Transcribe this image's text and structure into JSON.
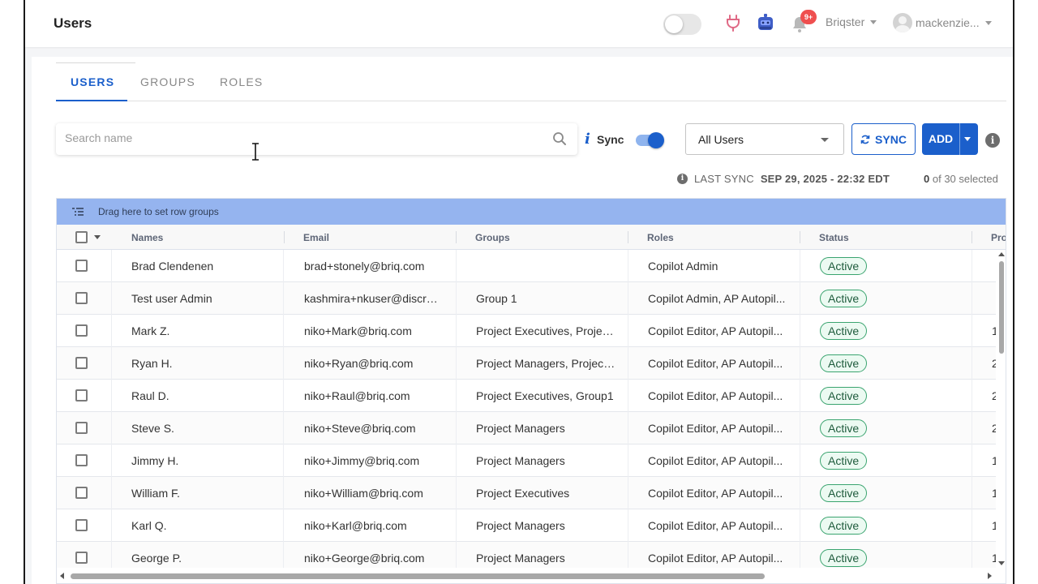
{
  "header": {
    "title": "Users",
    "notification_count": "9+",
    "org_name": "Briqster",
    "user_name": "mackenzie..."
  },
  "tabs": [
    {
      "label": "USERS",
      "active": true
    },
    {
      "label": "GROUPS",
      "active": false
    },
    {
      "label": "ROLES",
      "active": false
    }
  ],
  "toolbar": {
    "search_placeholder": "Search name",
    "search_value": "",
    "info_glyph": "i",
    "sync_label": "Sync",
    "sync_toggle_on": true,
    "filter_selected": "All Users",
    "sync_button": "SYNC",
    "add_button": "ADD",
    "help_glyph": "i"
  },
  "status": {
    "last_sync_label": "LAST SYNC",
    "last_sync_value": "SEP 29, 2025 - 22:32 EDT",
    "selected_count": "0",
    "selected_suffix": "of 30 selected"
  },
  "grid": {
    "group_panel_text": "Drag here to set row groups",
    "columns": [
      "Names",
      "Email",
      "Groups",
      "Roles",
      "Status",
      "Pro"
    ],
    "rows": [
      {
        "name": "Brad Clendenen",
        "email": "brad+stonely@briq.com",
        "groups": "",
        "roles": "Copilot Admin",
        "status": "Active",
        "extra": ""
      },
      {
        "name": "Test user Admin",
        "email": "kashmira+nkuser@discret...",
        "groups": "Group 1",
        "roles": "Copilot Admin, AP Autopil...",
        "status": "Active",
        "extra": ""
      },
      {
        "name": "Mark Z.",
        "email": "niko+Mark@briq.com",
        "groups": "Project Executives, Projec...",
        "roles": "Copilot Editor, AP Autopil...",
        "status": "Active",
        "extra": "1"
      },
      {
        "name": "Ryan H.",
        "email": "niko+Ryan@briq.com",
        "groups": "Project Managers, Project...",
        "roles": "Copilot Editor, AP Autopil...",
        "status": "Active",
        "extra": "2"
      },
      {
        "name": "Raul D.",
        "email": "niko+Raul@briq.com",
        "groups": "Project Executives, Group1",
        "roles": "Copilot Editor, AP Autopil...",
        "status": "Active",
        "extra": "2"
      },
      {
        "name": "Steve S.",
        "email": "niko+Steve@briq.com",
        "groups": "Project Managers",
        "roles": "Copilot Editor, AP Autopil...",
        "status": "Active",
        "extra": "2"
      },
      {
        "name": "Jimmy H.",
        "email": "niko+Jimmy@briq.com",
        "groups": "Project Managers",
        "roles": "Copilot Editor, AP Autopil...",
        "status": "Active",
        "extra": "1"
      },
      {
        "name": "William F.",
        "email": "niko+William@briq.com",
        "groups": "Project Executives",
        "roles": "Copilot Editor, AP Autopil...",
        "status": "Active",
        "extra": "1"
      },
      {
        "name": "Karl Q.",
        "email": "niko+Karl@briq.com",
        "groups": "Project Managers",
        "roles": "Copilot Editor, AP Autopil...",
        "status": "Active",
        "extra": "1"
      },
      {
        "name": "George P.",
        "email": "niko+George@briq.com",
        "groups": "Project Managers",
        "roles": "Copilot Editor, AP Autopil...",
        "status": "Active",
        "extra": "1"
      }
    ]
  },
  "icons": {
    "plug": "plug-icon",
    "bot": "bot-icon",
    "bell": "bell-icon",
    "search": "search-icon",
    "sync": "refresh-icon"
  },
  "colors": {
    "primary": "#1b5fcb",
    "group_panel": "#95b4ef",
    "active_badge_border": "#3aa46f",
    "notification_badge": "#ef4f4f"
  }
}
